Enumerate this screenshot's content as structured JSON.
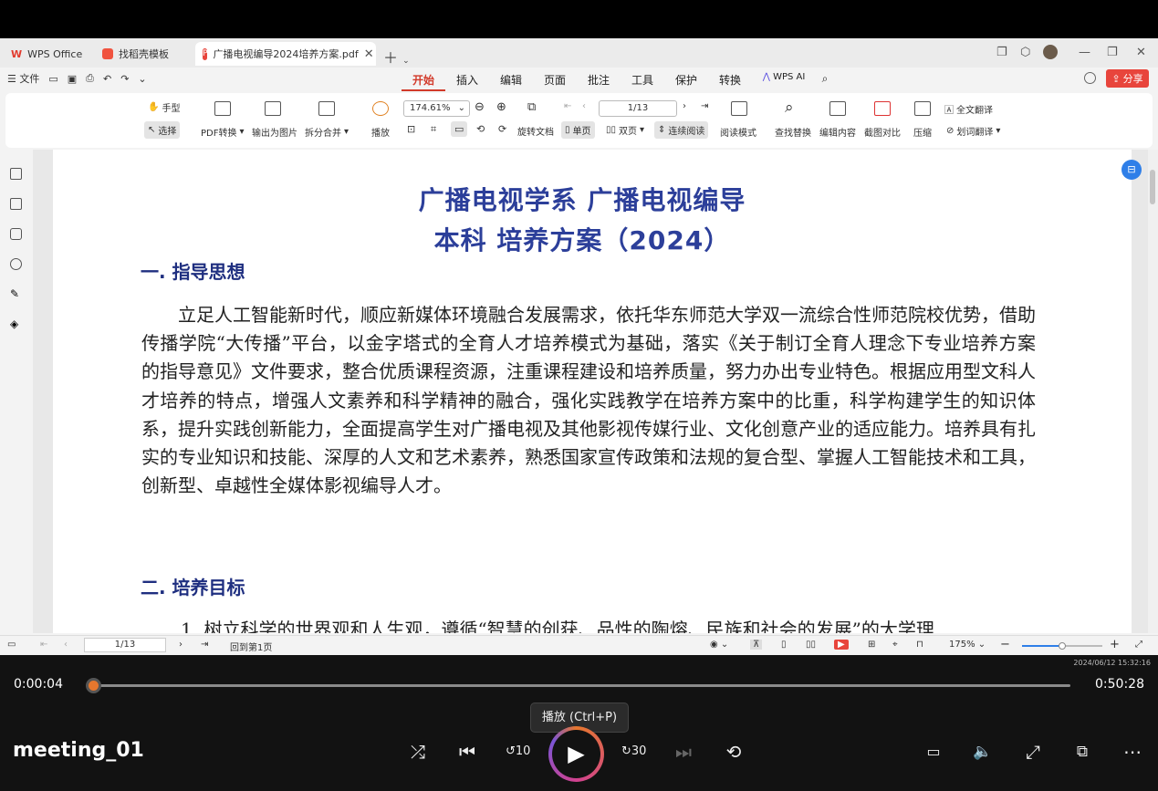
{
  "tabs": [
    {
      "label": "WPS Office"
    },
    {
      "label": "找稻壳模板"
    },
    {
      "label": "广播电视编导2024培养方案.pdf"
    }
  ],
  "menu": {
    "file": "文件",
    "tabs": [
      "开始",
      "插入",
      "编辑",
      "页面",
      "批注",
      "工具",
      "保护",
      "转换"
    ],
    "ai": "WPS AI",
    "share": "分享"
  },
  "ribbon": {
    "hand": "手型",
    "select": "选择",
    "pdf_convert": "PDF转换",
    "export_image": "输出为图片",
    "split_merge": "拆分合并",
    "play": "播放",
    "zoom": "174.61%",
    "page": "1/13",
    "rotate": "旋转文档",
    "single": "单页",
    "double": "双页",
    "continuous": "连续阅读",
    "read_mode": "阅读模式",
    "find_replace": "查找替换",
    "edit_content": "编辑内容",
    "screenshot_compare": "截图对比",
    "compress": "压缩",
    "full_translate": "全文翻译",
    "word_translate": "划词翻译"
  },
  "document": {
    "title_line1": "广播电视学系  广播电视编导",
    "title_line2": "本科  培养方案（2024）",
    "section1": "一. 指导思想",
    "para1": "立足人工智能新时代，顺应新媒体环境融合发展需求，依托华东师范大学双一流综合性师范院校优势，借助传播学院“大传播”平台，以金字塔式的全育人才培养模式为基础，落实《关于制订全育人理念下专业培养方案的指导意见》文件要求，整合优质课程资源，注重课程建设和培养质量，努力办出专业特色。根据应用型文科人才培养的特点，增强人文素养和科学精神的融合，强化实践教学在培养方案中的比重，科学构建学生的知识体系，提升实践创新能力，全面提高学生对广播电视及其他影视传媒行业、文化创意产业的适应能力。培养具有扎实的专业知识和技能、深厚的人文和艺术素养，熟悉国家宣传政策和法规的复合型、掌握人工智能技术和工具，创新型、卓越性全媒体影视编导人才。",
    "section2": "二. 培养目标",
    "para2": "1. 树立科学的世界观和人生观，遵循“智慧的创获、品性的陶熔、民族和社会的发展”的大学理"
  },
  "status": {
    "page": "1/13",
    "back_first": "回到第1页",
    "zoom": "175%",
    "zoom_level": 0.5
  },
  "player": {
    "timestamp": "2024/06/12 15:32:16",
    "current": "0:00:04",
    "total": "0:50:28",
    "progress": 0.001,
    "title": "meeting_01",
    "tooltip": "播放 (Ctrl+P)",
    "back_label": "10",
    "fwd_label": "30"
  }
}
